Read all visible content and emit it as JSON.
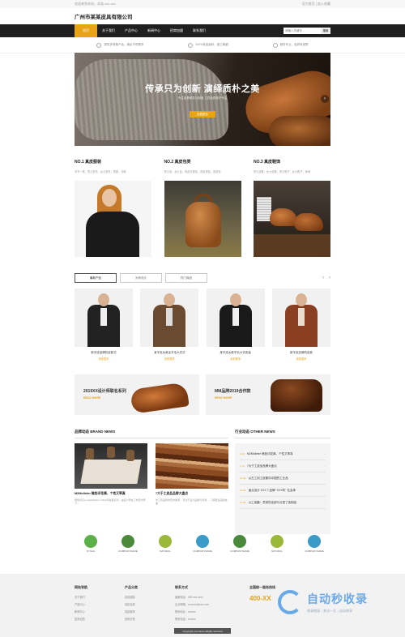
{
  "topbar": {
    "left": "欢迎来到本站，本站 xxx-xxx",
    "right": "设为首页 | 加入收藏"
  },
  "brand": {
    "name": "广州市某某皮具有限公司"
  },
  "nav": {
    "items": [
      "首页",
      "关于我们",
      "产品中心",
      "新闻中心",
      "招商加盟",
      "联系我们"
    ],
    "search_placeholder": "请输入关键字",
    "search_button": "搜索"
  },
  "features": [
    "提供多规格产品，满足不同需求",
    "100%真皮面料，做工精细",
    "服务专业，品质有保障"
  ],
  "banner": {
    "headline": "传承只为创新 演绎质朴之美",
    "sub": "专注皮具研发与制造 工匠品质源于专注",
    "button": "查看更多"
  },
  "categories": [
    {
      "title": "NO.1 真皮服装",
      "desc": "羊羊一族，男士皮衣，女士皮衣，短款，长款"
    },
    {
      "title": "NO.2 真皮包类",
      "desc": "男士包，女士包，真皮手提包，真皮钱包，真皮包"
    },
    {
      "title": "NO.3 真皮鞋饰",
      "desc": "男士皮鞋，女士皮鞋，男士靴子，女士靴子，休闲"
    }
  ],
  "tabs": [
    "最新产品",
    "为你设计",
    "热门商品"
  ],
  "tab_arrows": {
    "prev": "‹",
    "next": "›"
  },
  "products": [
    {
      "name": "新羊皮品牌机皮款式",
      "more": "查看更多"
    },
    {
      "name": "某羊皮女款全羊毛大衣式",
      "more": "查看更多"
    },
    {
      "name": "某羊皮女款羊毛大衣皮装",
      "more": "查看更多"
    },
    {
      "name": "新羊皮品牌机皮款",
      "more": "查看更多"
    }
  ],
  "promos": [
    {
      "title": "2019XX设计师联名系列",
      "more": "READ MORE"
    },
    {
      "title": "MM品牌2019合作款",
      "more": "READ MORE"
    }
  ],
  "brand_news": {
    "title": "品牌动态 BRAND NEWS",
    "items": [
      {
        "title": "M2Molleter 暗色印花裤，个性又率真",
        "desc": "暗色印花Lucia&Molleter 2019年春夏系列... 由设计师在工作室中研习..."
      },
      {
        "title": "7大于工皮品品牌大盘点",
        "desc": "羊工皮品牌的历史渊源... 专注于设计品质与传承 ... 了解更多品牌故事"
      }
    ]
  },
  "other_news": {
    "title": "行业动态 OTHER NEWS",
    "items": [
      {
        "date": "1.14",
        "text": "M2Molleter 暗色印花裤，个性又率真"
      },
      {
        "date": "1.14",
        "text": "7大于工皮品品牌大盘点"
      },
      {
        "date": "12-01",
        "text": "从古工到工皮都向中国的工业品"
      },
      {
        "date": "12-01",
        "text": "面点设计 XXX 7 品牌 \"XXX件\" 社会体"
      },
      {
        "date": "12-01",
        "text": "以工皮趣：意综的全部与分层了皮制品"
      }
    ]
  },
  "partners": [
    "NYUAA",
    "COMPANYNAME",
    "NATURAL",
    "COMPANYNAME",
    "COMPANYNAME",
    "NATURAL",
    "COMPANYNAME"
  ],
  "footer": {
    "cols": [
      {
        "head": "网站导航",
        "items": [
          "关于我们",
          "产品中心",
          "新闻中心",
          "招商加盟"
        ]
      },
      {
        "head": "产品分类",
        "items": [
          "真皮服装",
          "真皮包类",
          "真皮鞋饰",
          "其他分类"
        ]
      },
      {
        "head": "联系方式",
        "items": [
          "客服电话：400-xxx-xxxx",
          "企业邮箱：xxxxxxx@xxx.com",
          "联系地址：xxxxxx",
          "联系电话：xxxxxx"
        ]
      }
    ],
    "hotline_label": "全国统一服务热线",
    "hotline": "400-XX",
    "copyright": "Copyright yourname allright reserved"
  },
  "watermark": {
    "big": "自动秒收录",
    "small": "收录链接→来访一次→自动收录"
  }
}
